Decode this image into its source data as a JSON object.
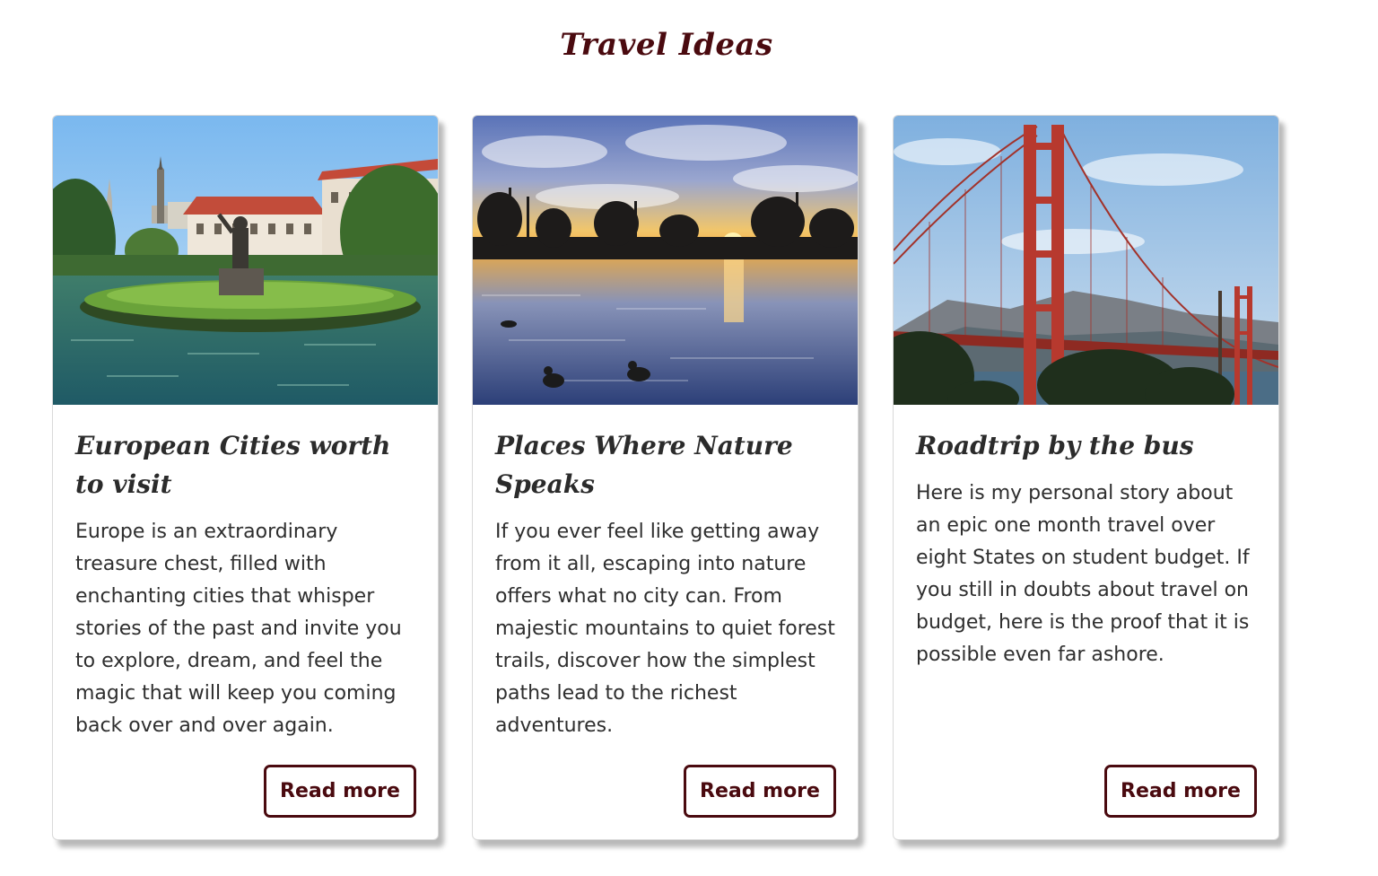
{
  "page": {
    "title": "Travel Ideas"
  },
  "colors": {
    "accent": "#4a0a0f",
    "text": "#2b2b2b",
    "background": "#ffffff"
  },
  "cards": [
    {
      "image": "fountain-palace-garden-photo",
      "title": "European Cities worth to visit",
      "text": "Europe is an extraordinary treasure chest, filled with enchanting cities that whisper stories of the past and invite you to explore, dream, and feel the magic that will keep you coming back over and over again.",
      "button_label": "Read more"
    },
    {
      "image": "sunset-lake-ducks-photo",
      "title": "Places Where Nature Speaks",
      "text": "If you ever feel like getting away from it all, escaping into nature offers what no city can. From majestic mountains to quiet forest trails, discover how the simplest paths lead to the richest adventures.",
      "button_label": "Read more"
    },
    {
      "image": "golden-gate-bridge-photo",
      "title": "Roadtrip by the bus",
      "text": "Here is my personal story about an epic one month travel over eight States on student budget. If you still in doubts about travel on budget, here is the proof that it is possible even far ashore.",
      "button_label": "Read more"
    }
  ]
}
